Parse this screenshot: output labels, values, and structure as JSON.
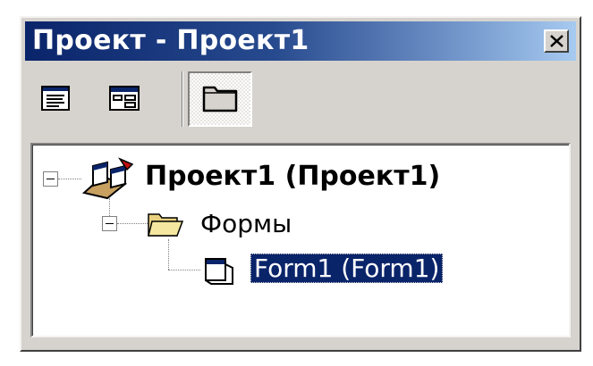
{
  "window": {
    "title": "Проект - Проект1",
    "close_icon": "close-icon"
  },
  "toolbar": {
    "buttons": [
      {
        "name": "view-code-button",
        "icon": "view-code-icon"
      },
      {
        "name": "view-object-button",
        "icon": "view-object-icon"
      },
      {
        "name": "toggle-folders-button",
        "icon": "folder-icon",
        "pressed": true
      }
    ]
  },
  "tree": {
    "project_label": "Проект1 (Проект1)",
    "forms_label": "Формы",
    "form1_label": "Form1 (Form1)"
  },
  "colors": {
    "title_start": "#0a246a",
    "title_end": "#a6caf0",
    "selection": "#0a246a",
    "face": "#d6d3ce"
  }
}
